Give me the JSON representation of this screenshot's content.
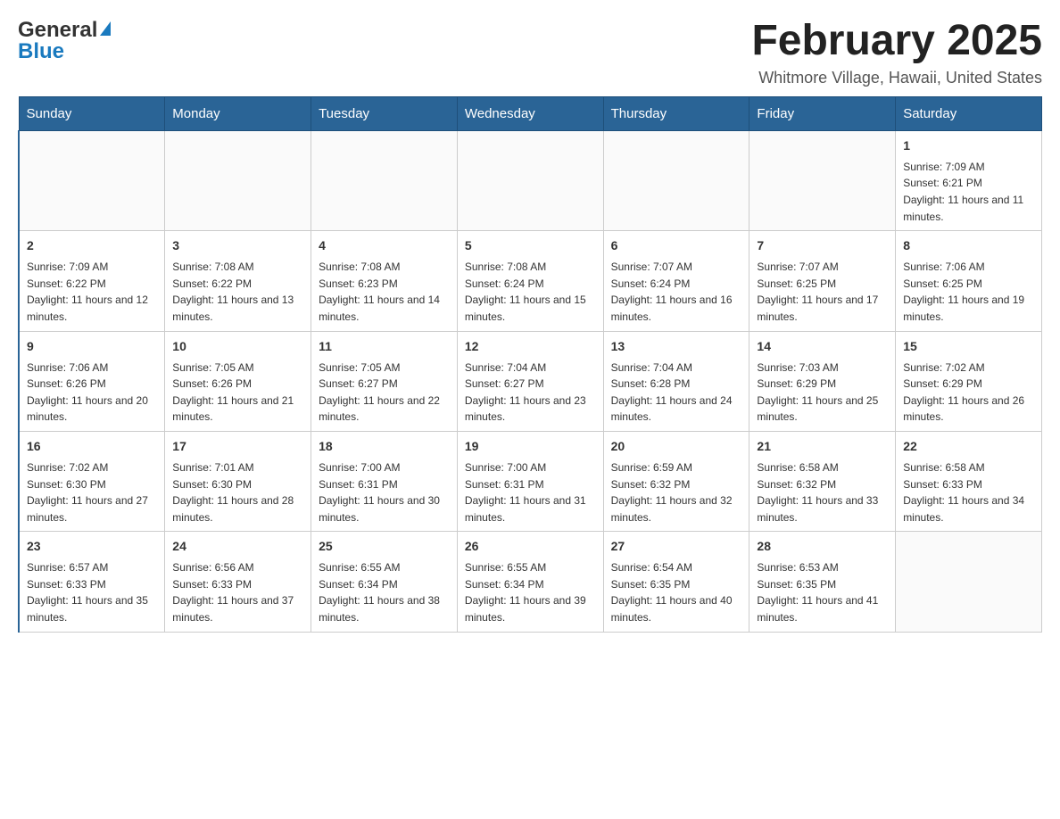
{
  "header": {
    "logo_general": "General",
    "logo_blue": "Blue",
    "title": "February 2025",
    "location": "Whitmore Village, Hawaii, United States"
  },
  "days_of_week": [
    "Sunday",
    "Monday",
    "Tuesday",
    "Wednesday",
    "Thursday",
    "Friday",
    "Saturday"
  ],
  "weeks": [
    [
      {
        "day": "",
        "info": ""
      },
      {
        "day": "",
        "info": ""
      },
      {
        "day": "",
        "info": ""
      },
      {
        "day": "",
        "info": ""
      },
      {
        "day": "",
        "info": ""
      },
      {
        "day": "",
        "info": ""
      },
      {
        "day": "1",
        "info": "Sunrise: 7:09 AM\nSunset: 6:21 PM\nDaylight: 11 hours and 11 minutes."
      }
    ],
    [
      {
        "day": "2",
        "info": "Sunrise: 7:09 AM\nSunset: 6:22 PM\nDaylight: 11 hours and 12 minutes."
      },
      {
        "day": "3",
        "info": "Sunrise: 7:08 AM\nSunset: 6:22 PM\nDaylight: 11 hours and 13 minutes."
      },
      {
        "day": "4",
        "info": "Sunrise: 7:08 AM\nSunset: 6:23 PM\nDaylight: 11 hours and 14 minutes."
      },
      {
        "day": "5",
        "info": "Sunrise: 7:08 AM\nSunset: 6:24 PM\nDaylight: 11 hours and 15 minutes."
      },
      {
        "day": "6",
        "info": "Sunrise: 7:07 AM\nSunset: 6:24 PM\nDaylight: 11 hours and 16 minutes."
      },
      {
        "day": "7",
        "info": "Sunrise: 7:07 AM\nSunset: 6:25 PM\nDaylight: 11 hours and 17 minutes."
      },
      {
        "day": "8",
        "info": "Sunrise: 7:06 AM\nSunset: 6:25 PM\nDaylight: 11 hours and 19 minutes."
      }
    ],
    [
      {
        "day": "9",
        "info": "Sunrise: 7:06 AM\nSunset: 6:26 PM\nDaylight: 11 hours and 20 minutes."
      },
      {
        "day": "10",
        "info": "Sunrise: 7:05 AM\nSunset: 6:26 PM\nDaylight: 11 hours and 21 minutes."
      },
      {
        "day": "11",
        "info": "Sunrise: 7:05 AM\nSunset: 6:27 PM\nDaylight: 11 hours and 22 minutes."
      },
      {
        "day": "12",
        "info": "Sunrise: 7:04 AM\nSunset: 6:27 PM\nDaylight: 11 hours and 23 minutes."
      },
      {
        "day": "13",
        "info": "Sunrise: 7:04 AM\nSunset: 6:28 PM\nDaylight: 11 hours and 24 minutes."
      },
      {
        "day": "14",
        "info": "Sunrise: 7:03 AM\nSunset: 6:29 PM\nDaylight: 11 hours and 25 minutes."
      },
      {
        "day": "15",
        "info": "Sunrise: 7:02 AM\nSunset: 6:29 PM\nDaylight: 11 hours and 26 minutes."
      }
    ],
    [
      {
        "day": "16",
        "info": "Sunrise: 7:02 AM\nSunset: 6:30 PM\nDaylight: 11 hours and 27 minutes."
      },
      {
        "day": "17",
        "info": "Sunrise: 7:01 AM\nSunset: 6:30 PM\nDaylight: 11 hours and 28 minutes."
      },
      {
        "day": "18",
        "info": "Sunrise: 7:00 AM\nSunset: 6:31 PM\nDaylight: 11 hours and 30 minutes."
      },
      {
        "day": "19",
        "info": "Sunrise: 7:00 AM\nSunset: 6:31 PM\nDaylight: 11 hours and 31 minutes."
      },
      {
        "day": "20",
        "info": "Sunrise: 6:59 AM\nSunset: 6:32 PM\nDaylight: 11 hours and 32 minutes."
      },
      {
        "day": "21",
        "info": "Sunrise: 6:58 AM\nSunset: 6:32 PM\nDaylight: 11 hours and 33 minutes."
      },
      {
        "day": "22",
        "info": "Sunrise: 6:58 AM\nSunset: 6:33 PM\nDaylight: 11 hours and 34 minutes."
      }
    ],
    [
      {
        "day": "23",
        "info": "Sunrise: 6:57 AM\nSunset: 6:33 PM\nDaylight: 11 hours and 35 minutes."
      },
      {
        "day": "24",
        "info": "Sunrise: 6:56 AM\nSunset: 6:33 PM\nDaylight: 11 hours and 37 minutes."
      },
      {
        "day": "25",
        "info": "Sunrise: 6:55 AM\nSunset: 6:34 PM\nDaylight: 11 hours and 38 minutes."
      },
      {
        "day": "26",
        "info": "Sunrise: 6:55 AM\nSunset: 6:34 PM\nDaylight: 11 hours and 39 minutes."
      },
      {
        "day": "27",
        "info": "Sunrise: 6:54 AM\nSunset: 6:35 PM\nDaylight: 11 hours and 40 minutes."
      },
      {
        "day": "28",
        "info": "Sunrise: 6:53 AM\nSunset: 6:35 PM\nDaylight: 11 hours and 41 minutes."
      },
      {
        "day": "",
        "info": ""
      }
    ]
  ]
}
